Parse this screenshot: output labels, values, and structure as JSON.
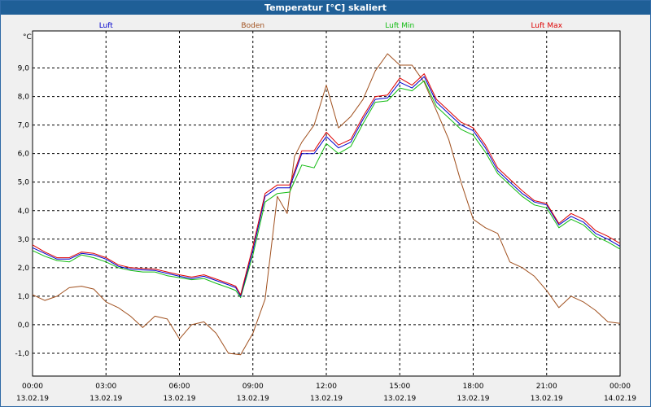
{
  "title": "Temperatur [°C] skaliert",
  "chart_data": {
    "type": "line",
    "title": "Temperatur [°C] skaliert",
    "ylabel": "°C",
    "ylim": [
      -1.8,
      10.3
    ],
    "yticks": [
      "-1,0",
      "0,0",
      "1,0",
      "2,0",
      "3,0",
      "4,0",
      "5,0",
      "6,0",
      "7,0",
      "8,0",
      "9,0"
    ],
    "xlim": [
      0,
      24
    ],
    "xticks": [
      {
        "time": "00:00",
        "date": "13.02.19"
      },
      {
        "time": "03:00",
        "date": "13.02.19"
      },
      {
        "time": "06:00",
        "date": "13.02.19"
      },
      {
        "time": "09:00",
        "date": "13.02.19"
      },
      {
        "time": "12:00",
        "date": "13.02.19"
      },
      {
        "time": "15:00",
        "date": "13.02.19"
      },
      {
        "time": "18:00",
        "date": "13.02.19"
      },
      {
        "time": "21:00",
        "date": "13.02.19"
      },
      {
        "time": "00:00",
        "date": "14.02.19"
      }
    ],
    "grid": true,
    "legend_position": "top",
    "series": [
      {
        "name": "Luft",
        "color": "#0000cc",
        "points": [
          [
            0,
            2.7
          ],
          [
            0.5,
            2.5
          ],
          [
            1,
            2.3
          ],
          [
            1.5,
            2.3
          ],
          [
            2,
            2.5
          ],
          [
            2.5,
            2.45
          ],
          [
            3,
            2.3
          ],
          [
            3.5,
            2.05
          ],
          [
            4,
            1.95
          ],
          [
            4.5,
            1.92
          ],
          [
            5,
            1.9
          ],
          [
            5.5,
            1.8
          ],
          [
            6,
            1.7
          ],
          [
            6.5,
            1.62
          ],
          [
            7,
            1.7
          ],
          [
            7.5,
            1.55
          ],
          [
            8,
            1.4
          ],
          [
            8.3,
            1.3
          ],
          [
            8.5,
            1.0
          ],
          [
            9,
            2.6
          ],
          [
            9.5,
            4.5
          ],
          [
            10,
            4.8
          ],
          [
            10.5,
            4.8
          ],
          [
            11,
            6.0
          ],
          [
            11.5,
            6.0
          ],
          [
            12,
            6.6
          ],
          [
            12.5,
            6.2
          ],
          [
            13,
            6.4
          ],
          [
            13.5,
            7.2
          ],
          [
            14,
            7.9
          ],
          [
            14.5,
            7.95
          ],
          [
            15,
            8.5
          ],
          [
            15.5,
            8.3
          ],
          [
            16,
            8.7
          ],
          [
            16.5,
            7.8
          ],
          [
            17,
            7.4
          ],
          [
            17.5,
            7.0
          ],
          [
            18,
            6.8
          ],
          [
            18.5,
            6.2
          ],
          [
            19,
            5.4
          ],
          [
            19.5,
            5.0
          ],
          [
            20,
            4.6
          ],
          [
            20.5,
            4.3
          ],
          [
            21,
            4.2
          ],
          [
            21.5,
            3.5
          ],
          [
            22,
            3.8
          ],
          [
            22.5,
            3.6
          ],
          [
            23,
            3.2
          ],
          [
            23.5,
            3.0
          ],
          [
            24,
            2.75
          ]
        ]
      },
      {
        "name": "Boden",
        "color": "#a0501e",
        "points": [
          [
            0,
            1.05
          ],
          [
            0.5,
            0.85
          ],
          [
            1,
            1.0
          ],
          [
            1.5,
            1.3
          ],
          [
            2,
            1.35
          ],
          [
            2.5,
            1.25
          ],
          [
            3,
            0.8
          ],
          [
            3.5,
            0.6
          ],
          [
            4,
            0.3
          ],
          [
            4.5,
            -0.1
          ],
          [
            5,
            0.3
          ],
          [
            5.5,
            0.2
          ],
          [
            6,
            -0.5
          ],
          [
            6.5,
            0.0
          ],
          [
            7,
            0.1
          ],
          [
            7.5,
            -0.3
          ],
          [
            8,
            -1.0
          ],
          [
            8.5,
            -1.05
          ],
          [
            9,
            -0.3
          ],
          [
            9.5,
            0.9
          ],
          [
            10,
            4.5
          ],
          [
            10.4,
            3.9
          ],
          [
            10.7,
            5.9
          ],
          [
            11,
            6.4
          ],
          [
            11.5,
            7.0
          ],
          [
            12,
            8.4
          ],
          [
            12.5,
            6.9
          ],
          [
            13,
            7.3
          ],
          [
            13.5,
            7.9
          ],
          [
            14,
            8.9
          ],
          [
            14.5,
            9.5
          ],
          [
            15,
            9.1
          ],
          [
            15.5,
            9.1
          ],
          [
            16,
            8.5
          ],
          [
            16.5,
            7.5
          ],
          [
            17,
            6.5
          ],
          [
            17.5,
            5.0
          ],
          [
            18,
            3.7
          ],
          [
            18.5,
            3.4
          ],
          [
            19,
            3.2
          ],
          [
            19.5,
            2.2
          ],
          [
            20,
            2.0
          ],
          [
            20.5,
            1.7
          ],
          [
            21,
            1.2
          ],
          [
            21.5,
            0.6
          ],
          [
            22,
            1.0
          ],
          [
            22.5,
            0.8
          ],
          [
            23,
            0.5
          ],
          [
            23.5,
            0.1
          ],
          [
            24,
            0.05
          ]
        ]
      },
      {
        "name": "Luft Min",
        "color": "#11bb11",
        "points": [
          [
            0,
            2.6
          ],
          [
            0.5,
            2.4
          ],
          [
            1,
            2.25
          ],
          [
            1.5,
            2.2
          ],
          [
            2,
            2.45
          ],
          [
            2.5,
            2.35
          ],
          [
            3,
            2.2
          ],
          [
            3.5,
            2.0
          ],
          [
            4,
            1.9
          ],
          [
            4.5,
            1.85
          ],
          [
            5,
            1.85
          ],
          [
            5.5,
            1.72
          ],
          [
            6,
            1.65
          ],
          [
            6.5,
            1.58
          ],
          [
            7,
            1.62
          ],
          [
            7.5,
            1.45
          ],
          [
            8,
            1.3
          ],
          [
            8.3,
            1.2
          ],
          [
            8.5,
            0.95
          ],
          [
            9,
            2.45
          ],
          [
            9.5,
            4.3
          ],
          [
            10,
            4.6
          ],
          [
            10.5,
            4.65
          ],
          [
            11,
            5.6
          ],
          [
            11.5,
            5.5
          ],
          [
            12,
            6.35
          ],
          [
            12.5,
            6.0
          ],
          [
            13,
            6.25
          ],
          [
            13.5,
            7.05
          ],
          [
            14,
            7.8
          ],
          [
            14.5,
            7.85
          ],
          [
            15,
            8.3
          ],
          [
            15.5,
            8.2
          ],
          [
            16,
            8.55
          ],
          [
            16.5,
            7.65
          ],
          [
            17,
            7.25
          ],
          [
            17.5,
            6.85
          ],
          [
            18,
            6.65
          ],
          [
            18.5,
            6.05
          ],
          [
            19,
            5.3
          ],
          [
            19.5,
            4.9
          ],
          [
            20,
            4.5
          ],
          [
            20.5,
            4.2
          ],
          [
            21,
            4.1
          ],
          [
            21.5,
            3.4
          ],
          [
            22,
            3.7
          ],
          [
            22.5,
            3.5
          ],
          [
            23,
            3.1
          ],
          [
            23.5,
            2.9
          ],
          [
            24,
            2.65
          ]
        ]
      },
      {
        "name": "Luft Max",
        "color": "#dd0000",
        "points": [
          [
            0,
            2.8
          ],
          [
            0.5,
            2.55
          ],
          [
            1,
            2.35
          ],
          [
            1.5,
            2.35
          ],
          [
            2,
            2.55
          ],
          [
            2.5,
            2.5
          ],
          [
            3,
            2.35
          ],
          [
            3.5,
            2.1
          ],
          [
            4,
            2.0
          ],
          [
            4.5,
            1.97
          ],
          [
            5,
            1.95
          ],
          [
            5.5,
            1.85
          ],
          [
            6,
            1.75
          ],
          [
            6.5,
            1.67
          ],
          [
            7,
            1.75
          ],
          [
            7.5,
            1.6
          ],
          [
            8,
            1.45
          ],
          [
            8.3,
            1.35
          ],
          [
            8.5,
            1.05
          ],
          [
            9,
            2.75
          ],
          [
            9.5,
            4.6
          ],
          [
            10,
            4.9
          ],
          [
            10.5,
            4.9
          ],
          [
            11,
            6.1
          ],
          [
            11.5,
            6.1
          ],
          [
            12,
            6.75
          ],
          [
            12.5,
            6.3
          ],
          [
            13,
            6.5
          ],
          [
            13.5,
            7.3
          ],
          [
            14,
            8.0
          ],
          [
            14.5,
            8.05
          ],
          [
            15,
            8.65
          ],
          [
            15.5,
            8.4
          ],
          [
            16,
            8.8
          ],
          [
            16.5,
            7.9
          ],
          [
            17,
            7.5
          ],
          [
            17.5,
            7.1
          ],
          [
            18,
            6.9
          ],
          [
            18.5,
            6.3
          ],
          [
            19,
            5.5
          ],
          [
            19.5,
            5.1
          ],
          [
            20,
            4.7
          ],
          [
            20.5,
            4.35
          ],
          [
            21,
            4.25
          ],
          [
            21.5,
            3.55
          ],
          [
            22,
            3.9
          ],
          [
            22.5,
            3.7
          ],
          [
            23,
            3.3
          ],
          [
            23.5,
            3.1
          ],
          [
            24,
            2.85
          ]
        ]
      }
    ]
  }
}
